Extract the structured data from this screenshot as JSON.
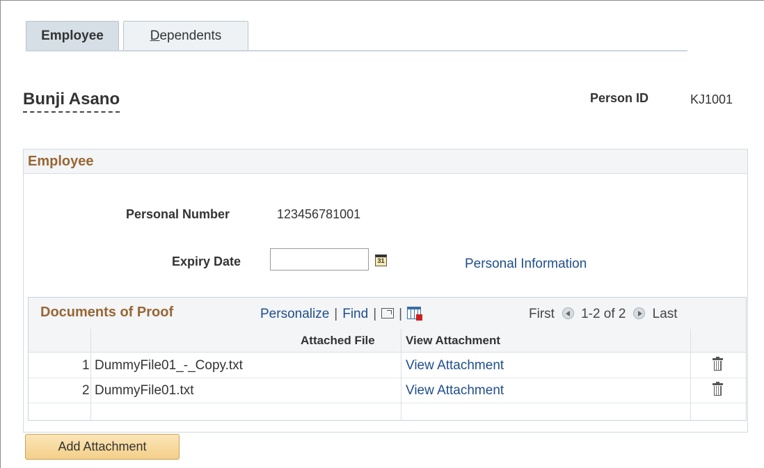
{
  "tabs": [
    {
      "label_first": "Employee",
      "label_rest": ""
    },
    {
      "label_first": "D",
      "label_rest": "ependents"
    }
  ],
  "header": {
    "person_name": "Bunji Asano",
    "person_id_label": "Person ID",
    "person_id_value": "KJ1001"
  },
  "employee_section": {
    "title": "Employee",
    "personal_number_label": "Personal Number",
    "personal_number_value": "123456781001",
    "expiry_date_label": "Expiry Date",
    "expiry_date_value": "",
    "calendar_icon": "calendar-icon",
    "calendar_icon_text": "31",
    "personal_info_link": "Personal Information"
  },
  "documents_grid": {
    "title": "Documents of Proof",
    "toolbar": {
      "personalize": "Personalize",
      "sep": "|",
      "find": "Find",
      "zoom_icon": "new-window-icon",
      "download_icon": "download-spreadsheet-icon"
    },
    "pager": {
      "first": "First",
      "range": "1-2 of 2",
      "last": "Last"
    },
    "columns": {
      "attached_file": "Attached File",
      "view_attachment": "View Attachment"
    },
    "rows": [
      {
        "num": "1",
        "file": "DummyFile01_-_Copy.txt",
        "view": "View Attachment"
      },
      {
        "num": "2",
        "file": "DummyFile01.txt",
        "view": "View Attachment"
      }
    ],
    "delete_icon": "trash-icon"
  },
  "add_attachment_button": "Add Attachment",
  "colors": {
    "section_title": "#996633",
    "link": "#1f4e8c",
    "button": "#f4cf89"
  }
}
